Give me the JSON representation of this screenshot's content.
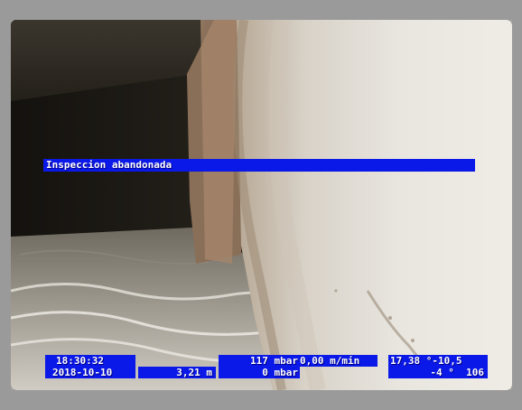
{
  "overlay": {
    "banner": "Inspeccion abandonada",
    "time": "18:30:32",
    "date": "2018-10-10",
    "distance": "3,21 m",
    "pressure_top": "117 mbar",
    "pressure_bottom": "0 mbar",
    "speed": "0,00 m/min",
    "angle_top": "17,38 °-10,5",
    "angle_bottom": "-4 °  106"
  },
  "colors": {
    "osd_background": "#0a18e8",
    "osd_text": "#ffffff"
  }
}
